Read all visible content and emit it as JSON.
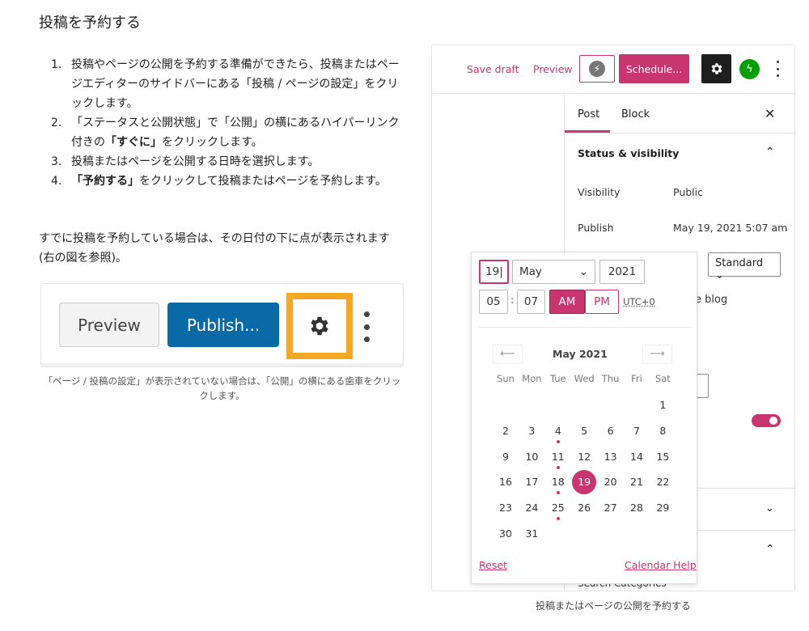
{
  "title": "投稿を予約する",
  "steps": [
    {
      "num": "1.",
      "text": "投稿やページの公開を予約する準備ができたら、投稿またはページエディターのサイドバーにある「投稿 / ページの設定」をクリックします。"
    },
    {
      "num": "2.",
      "pre": "「ステータスと公開状態」で「公開」の横にあるハイパーリンク付きの",
      "bold": "「すぐに」",
      "post": "をクリックします。"
    },
    {
      "num": "3.",
      "text": "投稿またはページを公開する日時を選択します。"
    },
    {
      "num": "4.",
      "bold": "「予約する」",
      "post": "をクリックして投稿またはページを予約します。"
    }
  ],
  "note": "すでに投稿を予約している場合は、その日付の下に点が表示されます (右の図を参照)。",
  "figure1": {
    "preview": "Preview",
    "publish": "Publish...",
    "caption": "「ページ / 投稿の設定」が表示されていない場合は、「公開」の横にある歯車をクリックします。",
    "highlight_color": "#f5a623"
  },
  "editor": {
    "toolbar": {
      "save_draft": "Save draft",
      "preview": "Preview",
      "schedule": "Schedule...",
      "accent": "#c9356e"
    },
    "tabs": {
      "post": "Post",
      "block": "Block"
    },
    "status_header": "Status & visibility",
    "visibility_label": "Visibility",
    "visibility_value": "Public",
    "publish_label": "Publish",
    "publish_value": "May 19, 2021 5:07 am",
    "format_value": "Standard",
    "partial_blog": "e blog",
    "partial_search": "Search Categories",
    "sticky_toggle_on": true
  },
  "picker": {
    "day": "19",
    "month": "May",
    "year": "2021",
    "hours": "05",
    "minutes": "07",
    "am": "AM",
    "pm": "PM",
    "meridiem": "AM",
    "timezone": "UTC+0",
    "month_title": "May 2021",
    "weekdays": [
      "Sun",
      "Mon",
      "Tue",
      "Wed",
      "Thu",
      "Fri",
      "Sat"
    ],
    "first_weekday_index": 6,
    "days_in_month": 31,
    "selected": 19,
    "scheduled_days": [
      4,
      11,
      18,
      25
    ],
    "reset": "Reset",
    "help": "Calendar Help"
  },
  "caption2": "投稿またはページの公開を予約する"
}
